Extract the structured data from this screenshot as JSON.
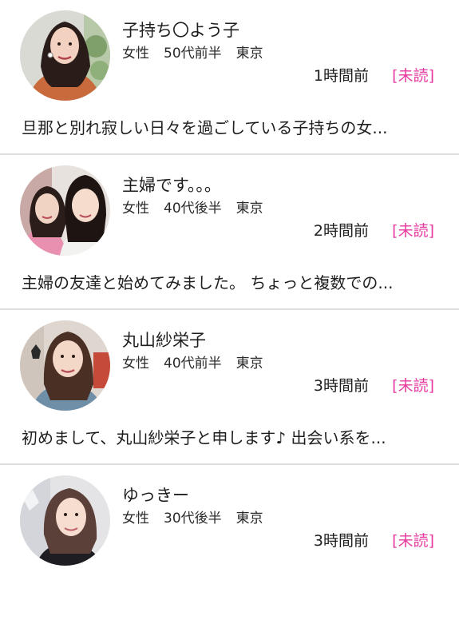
{
  "messages": [
    {
      "name": "子持ち〇よう子",
      "gender": "女性",
      "age": "50代前半",
      "location": "東京",
      "time": "1時間前",
      "status": "[未読]",
      "preview": "旦那と別れ寂しい日々を過ごしている子持ちの女..."
    },
    {
      "name": "主婦です。。。",
      "gender": "女性",
      "age": "40代後半",
      "location": "東京",
      "time": "2時間前",
      "status": "[未読]",
      "preview": "主婦の友達と始めてみました。 ちょっと複数での..."
    },
    {
      "name": "丸山紗栄子",
      "gender": "女性",
      "age": "40代前半",
      "location": "東京",
      "time": "3時間前",
      "status": "[未読]",
      "preview": "初めまして、丸山紗栄子と申します♪ 出会い系を..."
    },
    {
      "name": "ゆっきー",
      "gender": "女性",
      "age": "30代後半",
      "location": "東京",
      "time": "3時間前",
      "status": "[未読]",
      "preview": ""
    }
  ],
  "colors": {
    "unread": "#e63ba0",
    "divider": "#dedede"
  }
}
